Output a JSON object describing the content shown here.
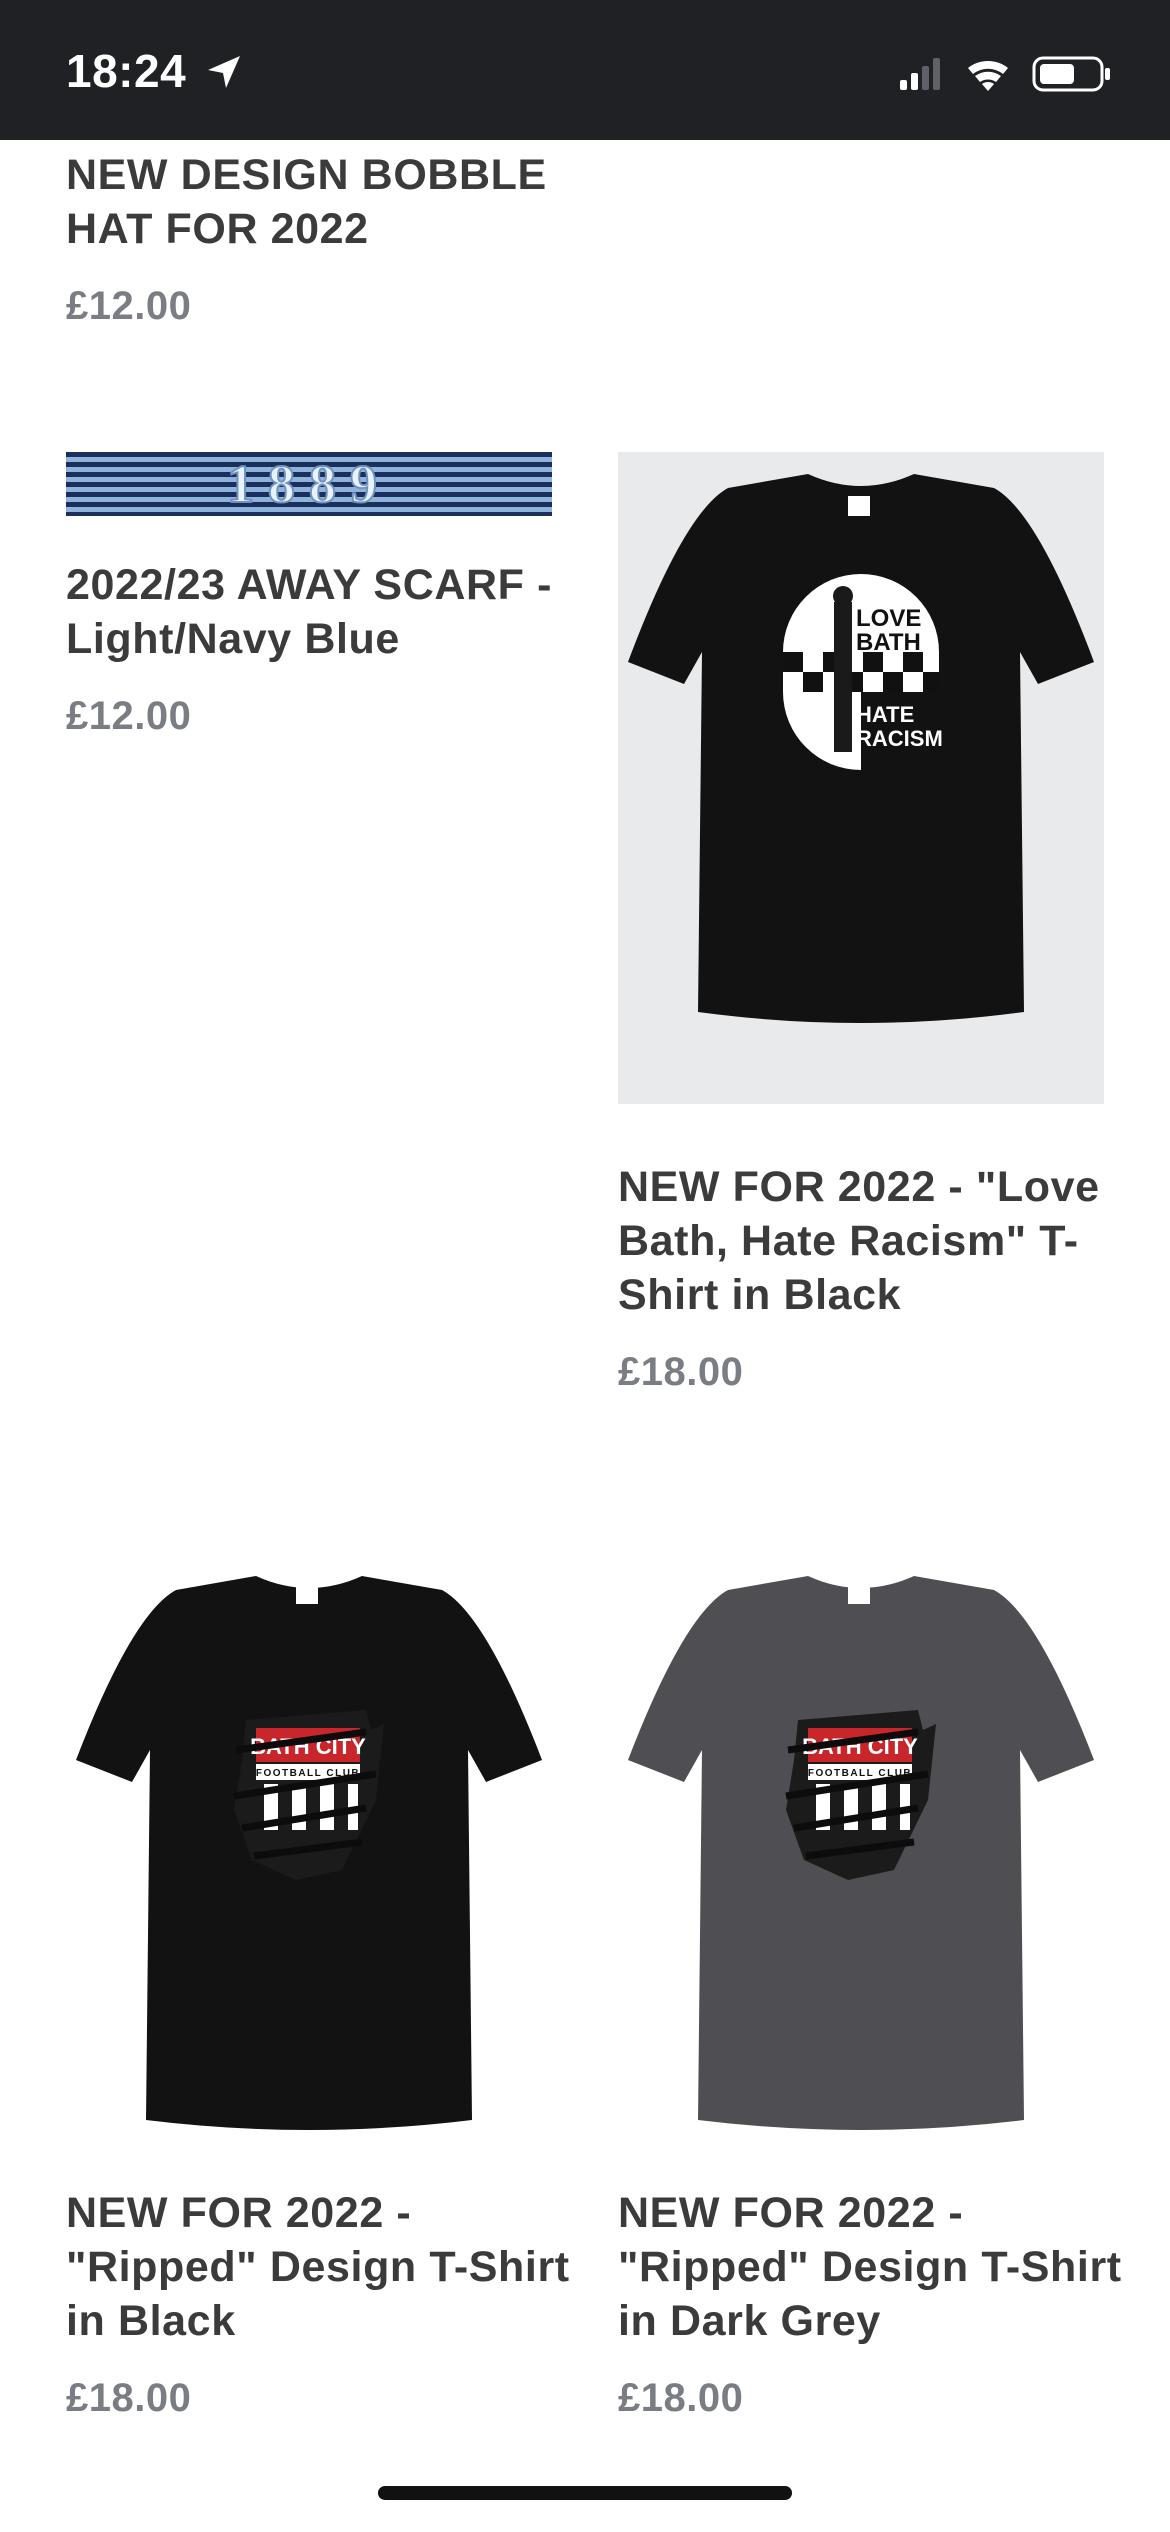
{
  "status_bar": {
    "time": "18:24",
    "icons": [
      "location-arrow-icon",
      "cellular-signal-icon",
      "wifi-icon",
      "battery-icon"
    ]
  },
  "products": [
    {
      "title": "NEW DESIGN BOBBLE HAT FOR 2022",
      "price": "£12.00"
    },
    {
      "title": "2022/23 AWAY SCARF - Light/Navy Blue",
      "price": "£12.00",
      "image_text": "1889"
    },
    {
      "title": "NEW FOR 2022 - \"Love Bath, Hate Racism\" T-Shirt in Black",
      "price": "£18.00",
      "image_text": [
        "LOVE",
        "BATH",
        "HATE",
        "RACISM"
      ]
    },
    {
      "title": "NEW FOR 2022 - \"Ripped\" Design T-Shirt in Black",
      "price": "£18.00",
      "image_text": [
        "BATH CITY",
        "FOOTBALL CLUB"
      ]
    },
    {
      "title": "NEW FOR 2022 - \"Ripped\" Design T-Shirt in Dark Grey",
      "price": "£18.00",
      "image_text": [
        "BATH CITY",
        "FOOTBALL CLUB"
      ]
    }
  ],
  "colors": {
    "status_bar_bg": "#202124",
    "title_text": "#3b3b3b",
    "price_text": "#7a7e84",
    "scarf_light_blue": "#8fb4dc",
    "scarf_navy": "#1c2f5c",
    "tshirt_black": "#121212",
    "tshirt_dark_grey": "#4f4f53",
    "badge_red": "#c9262c"
  }
}
